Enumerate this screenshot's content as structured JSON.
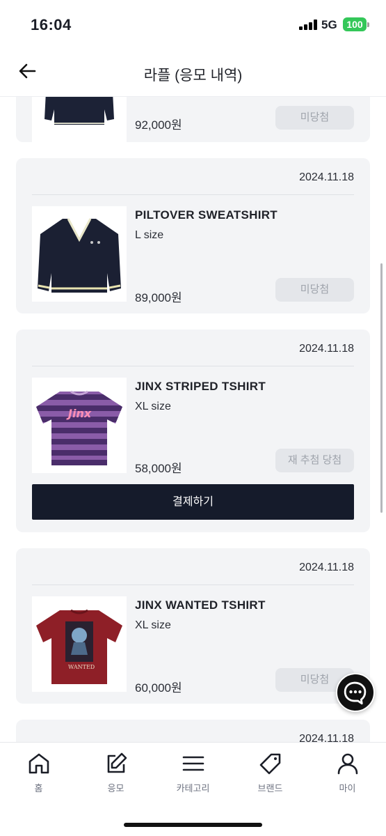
{
  "status_bar": {
    "time": "16:04",
    "network": "5G",
    "battery": "100"
  },
  "header": {
    "title": "라플 (응모 내역)"
  },
  "cards": [
    {
      "date": "",
      "name": "",
      "size": "",
      "price": "92,000원",
      "status": "미당첨",
      "has_pay": false
    },
    {
      "date": "2024.11.18",
      "name": "PILTOVER SWEATSHIRT",
      "size": "L size",
      "price": "89,000원",
      "status": "미당첨",
      "has_pay": false
    },
    {
      "date": "2024.11.18",
      "name": "JINX STRIPED TSHIRT",
      "size": "XL size",
      "price": "58,000원",
      "status": "재 추첨 당첨",
      "has_pay": true,
      "pay_label": "결제하기"
    },
    {
      "date": "2024.11.18",
      "name": "JINX WANTED TSHIRT",
      "size": "XL size",
      "price": "60,000원",
      "status": "미당첨",
      "has_pay": false
    },
    {
      "date": "2024.11.18"
    }
  ],
  "tabbar": {
    "items": [
      {
        "label": "홈",
        "icon": "home-icon"
      },
      {
        "label": "응모",
        "icon": "edit-icon"
      },
      {
        "label": "카테고리",
        "icon": "menu-icon"
      },
      {
        "label": "브랜드",
        "icon": "tag-icon"
      },
      {
        "label": "마이",
        "icon": "user-icon"
      }
    ]
  },
  "colors": {
    "card_bg": "#f3f4f6",
    "pay_button": "#151b2b",
    "status_button_bg": "#e4e6ea",
    "battery": "#34c759"
  }
}
